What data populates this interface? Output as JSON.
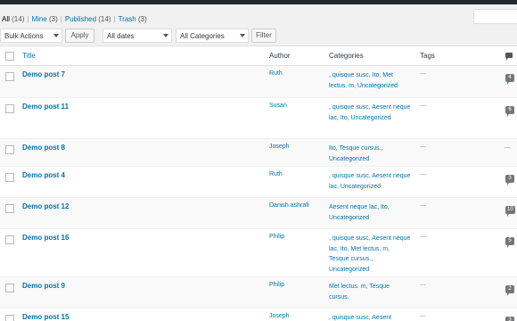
{
  "filters": {
    "all": "All",
    "all_count": "(14)",
    "mine": "Mine",
    "mine_count": "(3)",
    "published": "Published",
    "published_count": "(14)",
    "trash": "Trash",
    "trash_count": "(3)",
    "sep": "|"
  },
  "toolbar": {
    "bulk_actions": "Bulk Actions",
    "apply": "Apply",
    "dates": "All dates",
    "categories": "All Categories",
    "filter": "Filter"
  },
  "columns": {
    "title": "Title",
    "author": "Author",
    "categories": "Categories",
    "tags": "Tags"
  },
  "rows": [
    {
      "title": "Demo post 7",
      "author": "Ruth",
      "categories": ", quisque susc, Ito, Met lectus. m, Uncategorized",
      "tags": "—",
      "comments": "4"
    },
    {
      "title": "Demo post 11",
      "author": "Susan",
      "categories": ", quisque susc, Aesent neque lac, Ito, Uncategorized",
      "tags": "—",
      "comments": "6"
    },
    {
      "title": "Demo post 8",
      "author": "Joseph",
      "categories": "Ito, Tesque cursus., Uncategorized",
      "tags": "—",
      "comments": "—"
    },
    {
      "title": "Demo post 4",
      "author": "Ruth",
      "categories": ", quisque susc, Aesent neque lac, Uncategorized",
      "tags": "—",
      "comments": "3"
    },
    {
      "title": "Demo post 12",
      "author": "Danish ashrafi",
      "categories": "Aesent neque lac, Ito, Uncategorized",
      "tags": "—",
      "comments": "10"
    },
    {
      "title": "Demo post 16",
      "author": "Philip",
      "categories": ", quisque susc, Aesent neque lac, Ito, Met lectus. m, Tesque cursus., Uncategorized",
      "tags": "—",
      "comments": "5"
    },
    {
      "title": "Demo post 9",
      "author": "Philip",
      "categories": "Met lectus. m, Tesque cursus.",
      "tags": "—",
      "comments": "2"
    },
    {
      "title": "Demo post 15",
      "author": "Joseph",
      "categories": ", quisque susc, Aesent",
      "tags": "—",
      "comments": "3"
    }
  ]
}
